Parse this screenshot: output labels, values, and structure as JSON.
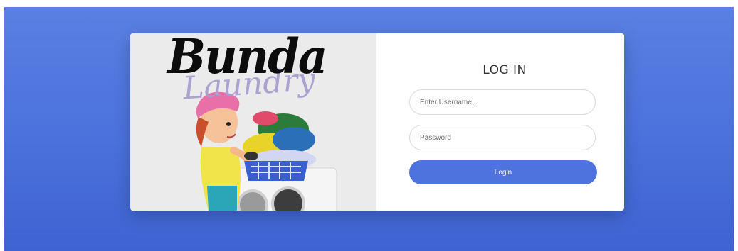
{
  "brand": {
    "logo_main": "Bunda",
    "logo_sub": "Laundry"
  },
  "login": {
    "title": "LOG IN",
    "username_placeholder": "Enter Username...",
    "password_placeholder": "Password",
    "button_label": "Login"
  },
  "colors": {
    "background_gradient_top": "#5a80e3",
    "background_gradient_bottom": "#3f63d2",
    "button": "#4f73de",
    "logo_sub": "#a99fcf"
  }
}
